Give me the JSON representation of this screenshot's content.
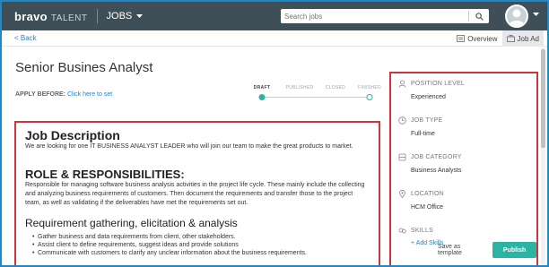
{
  "header": {
    "brand": "bravo",
    "brand_suffix": "TALENT",
    "module": "JOBS",
    "search_placeholder": "Search jobs"
  },
  "subbar": {
    "back_label": "< Back",
    "tabs": [
      {
        "label": "Overview",
        "icon": "overview-icon",
        "active": false
      },
      {
        "label": "Job Ad",
        "icon": "briefcase-icon",
        "active": true
      }
    ]
  },
  "job": {
    "title": "Senior Busines Analyst",
    "apply_before_label": "APPLY BEFORE:",
    "apply_before_link": "Click here to set"
  },
  "status_steps": [
    {
      "label": "DRAFT",
      "state": "current"
    },
    {
      "label": "PUBLISHED",
      "state": "pending"
    },
    {
      "label": "CLOSED",
      "state": "pending"
    },
    {
      "label": "FINISHED",
      "state": "pending"
    }
  ],
  "description": {
    "heading": "Job Description",
    "intro": "We are looking for one IT BUSINESS ANALYST LEADER who will join our team to make the great products to market.",
    "role_heading": "ROLE & RESPONSIBILITIES:",
    "role_text": "Responsible for managing software business analysis activities in the project life cycle. These mainly include the collecting and analyzing business requirements of customers. Then document the requirements and transfer those to the project team, as well as validating if the deliverables have met the requirements set out.",
    "sub_heading": "Requirement gathering, elicitation & analysis",
    "bullets": [
      "Gather business and data requirements from client, other stakeholders.",
      "Assist client to define requirements, suggest ideas and provide solutions",
      "Communicate with customers to clarify any unclear information about the business requirements."
    ]
  },
  "panel": {
    "fields": [
      {
        "label": "POSITION LEVEL",
        "value": "Experienced",
        "icon": "user-level-icon"
      },
      {
        "label": "JOB TYPE",
        "value": "Full-time",
        "icon": "clock-icon"
      },
      {
        "label": "JOB CATEGORY",
        "value": "Business Analysts",
        "icon": "category-icon"
      },
      {
        "label": "LOCATION",
        "value": "HCM Office",
        "icon": "location-pin-icon"
      }
    ],
    "skills_label": "SKILLS",
    "add_skills": "+ Add Skills",
    "save_template": "Save as template",
    "publish": "Publish"
  },
  "colors": {
    "topbar": "#3f4f57",
    "accent": "#1e88c8",
    "publish": "#2bb3a4",
    "highlight_border": "#d0343b"
  }
}
